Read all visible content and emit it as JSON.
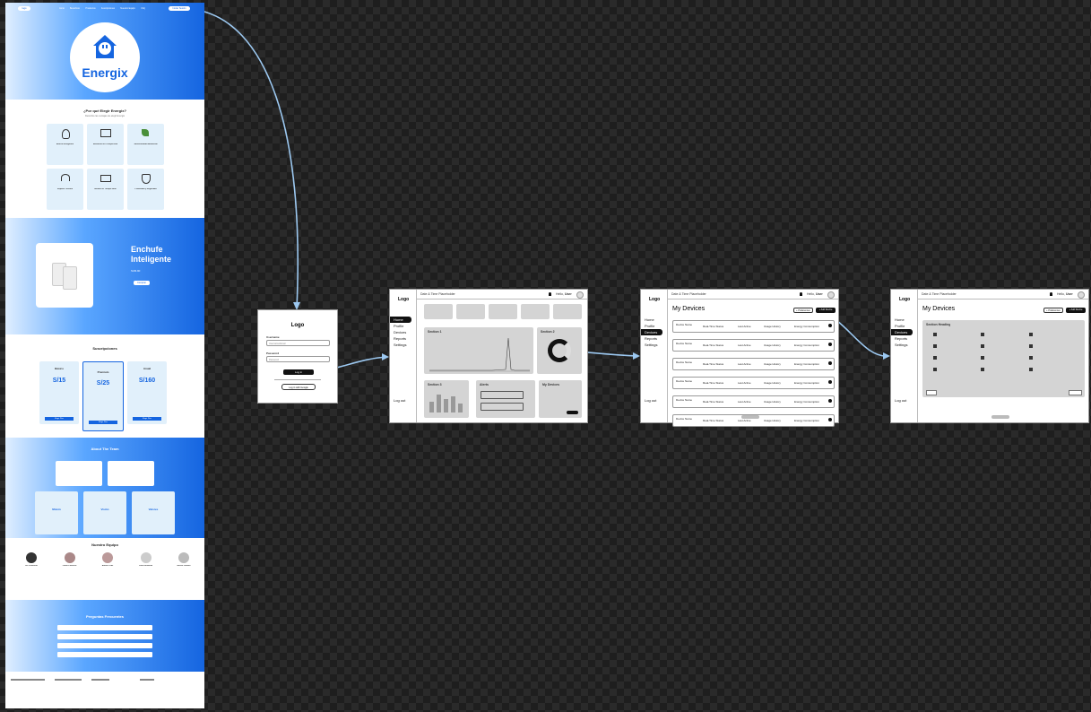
{
  "landing": {
    "nav": {
      "logo": "logo",
      "links": [
        "Inicio",
        "Beneficios",
        "Productos",
        "Suscripciones",
        "Nuestro Equipo",
        "FAQ"
      ],
      "cta": "Iniciar Sesión"
    },
    "brand": "Energix",
    "why": {
      "title": "¿Por qué Elegir Energix?",
      "subtitle": "Descubre las ventajas de elegir Energix",
      "cards": [
        {
          "title": "Ahorro Energético",
          "icon": "bulb-icon"
        },
        {
          "title": "Monitoreo en Tiempo Real",
          "icon": "monitor-icon"
        },
        {
          "title": "Sostenibilidad Ambiental",
          "icon": "leaf-icon"
        },
        {
          "title": "Soporte Técnico",
          "icon": "headset-icon"
        },
        {
          "title": "Alertas en Tiempo Real",
          "icon": "mail-icon"
        },
        {
          "title": "Privacidad y Seguridad",
          "icon": "shield-icon"
        }
      ]
    },
    "product": {
      "title_line1": "Enchufe",
      "title_line2": "Inteligente",
      "price": "S/29.90",
      "button": "Comprar"
    },
    "plans": {
      "title": "Suscripciones",
      "items": [
        {
          "name": "Básico",
          "price": "S/15",
          "button": "Elegir Plan"
        },
        {
          "name": "Premium",
          "price": "S/25",
          "button": "Elegir Plan"
        },
        {
          "name": "Anual",
          "price": "S/160",
          "button": "Elegir Plan"
        }
      ]
    },
    "about": {
      "title": "About The Team",
      "cards": [
        "Misión",
        "Visión",
        "Valores"
      ]
    },
    "team": {
      "title": "Nuestro Equipo",
      "members": [
        "Iris Palomino",
        "Frank Pacheco",
        "Adrián Ortiz",
        "Julio Mendoza",
        "Nilson Landeo"
      ]
    },
    "faq": {
      "title": "Preguntas Frecuentes"
    }
  },
  "login": {
    "logo": "Logo",
    "username_label": "Username",
    "username_placeholder": "Username/Email",
    "password_label": "Password",
    "password_placeholder": "Password",
    "login_button": "Log in",
    "google_button": "Log in with Google"
  },
  "dashboard": {
    "logo": "Logo",
    "header": "Date & Time Placeholder",
    "greeting": "Hello,",
    "user": "User",
    "nav": [
      "Home",
      "Profile",
      "Devices",
      "Reports",
      "Settings"
    ],
    "logout": "Log out",
    "sections": {
      "s1": "Section 1",
      "s2": "Section 2",
      "s3": "Section 3",
      "alerts": "Alerts",
      "devices": "My Devices"
    }
  },
  "devices": {
    "logo": "Logo",
    "header": "Date & Time Placeholder",
    "greeting": "Hello,",
    "user": "User",
    "title": "My Devices",
    "preferences": "+ Preferences",
    "add": "+ Add Device",
    "row": {
      "name": "Device Name",
      "status": "Real-Time Status",
      "last": "Last Active",
      "hist": "Usage History",
      "consumption": "Energy Consumption"
    },
    "nav": [
      "Home",
      "Profile",
      "Devices",
      "Reports",
      "Settings"
    ],
    "logout": "Log out"
  },
  "prefs": {
    "logo": "Logo",
    "header": "Date & Time Placeholder",
    "greeting": "Hello,",
    "user": "User",
    "title": "My Devices",
    "preferences": "+ Preferences",
    "add": "+ Add Device",
    "section": "Section Heading",
    "nav": [
      "Home",
      "Profile",
      "Devices",
      "Reports",
      "Settings"
    ],
    "logout": "Log out"
  },
  "colors": {
    "brand": "#1565e0",
    "connector": "#9cc8f0"
  }
}
